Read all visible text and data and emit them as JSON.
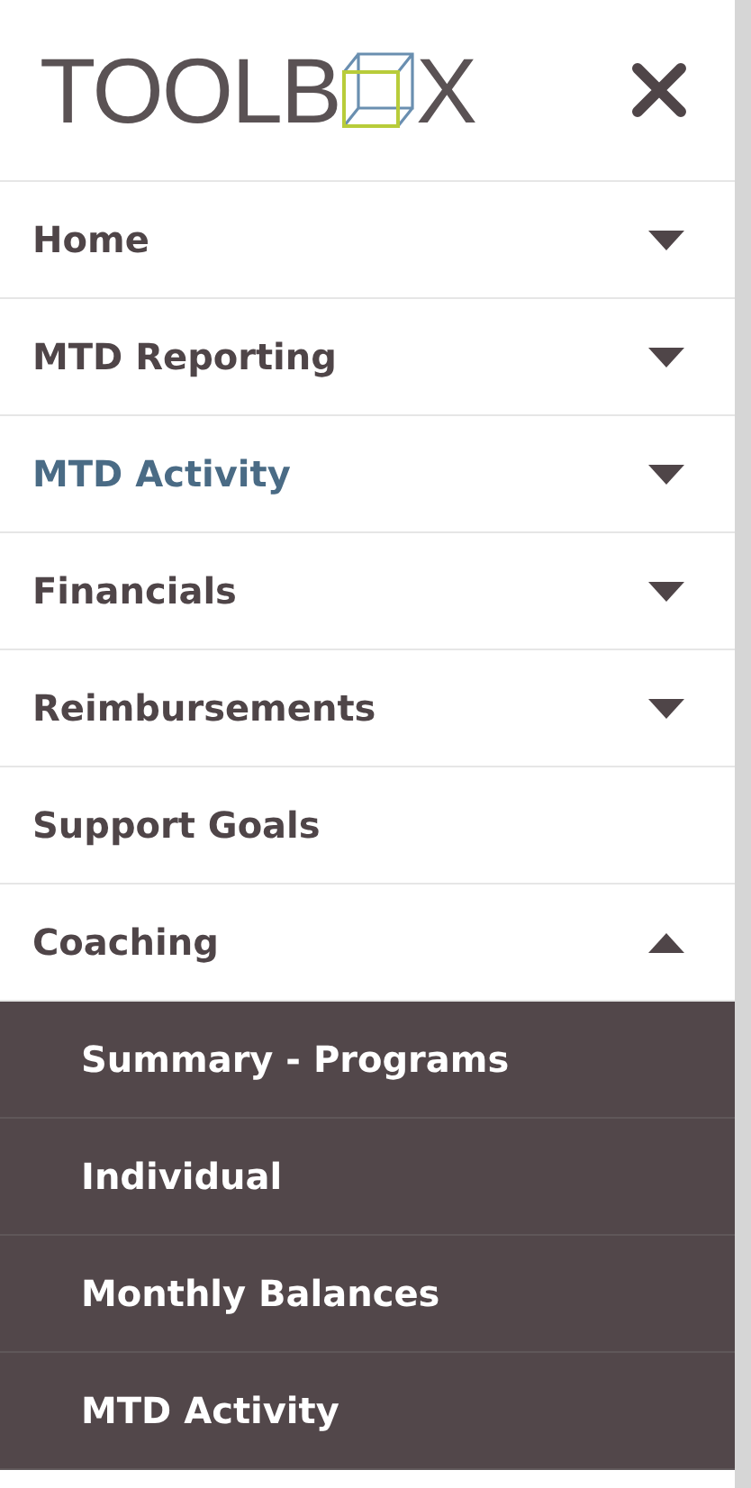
{
  "logo": {
    "before": "TOOLB",
    "after": "X"
  },
  "menu": [
    {
      "label": "Home",
      "kind": "dropdown",
      "expanded": false,
      "selected": false
    },
    {
      "label": "MTD Reporting",
      "kind": "dropdown",
      "expanded": false,
      "selected": false
    },
    {
      "label": "MTD Activity",
      "kind": "dropdown",
      "expanded": false,
      "selected": true
    },
    {
      "label": "Financials",
      "kind": "dropdown",
      "expanded": false,
      "selected": false
    },
    {
      "label": "Reimbursements",
      "kind": "dropdown",
      "expanded": false,
      "selected": false
    },
    {
      "label": "Support Goals",
      "kind": "link",
      "selected": false
    },
    {
      "label": "Coaching",
      "kind": "dropdown",
      "expanded": true,
      "selected": false,
      "children": [
        {
          "label": "Summary - Programs"
        },
        {
          "label": "Individual"
        },
        {
          "label": "Monthly Balances"
        },
        {
          "label": "MTD Activity"
        }
      ]
    }
  ]
}
